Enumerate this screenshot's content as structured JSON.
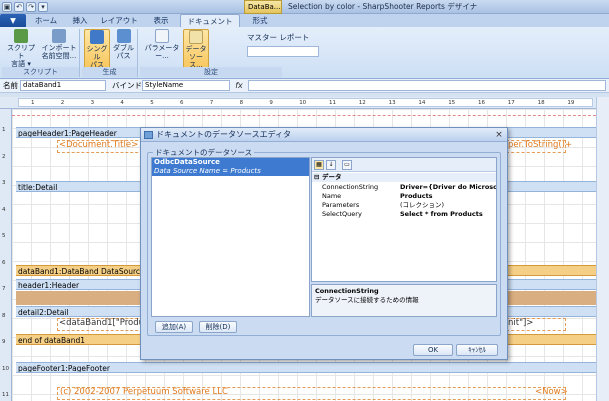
{
  "titlebar": {
    "context_tab": "DataBa...",
    "title": "Selection by color - SharpShooter Reports デザイナ",
    "qat": [
      "undo",
      "redo",
      "dropdown"
    ]
  },
  "tabs": [
    {
      "label": "ホーム"
    },
    {
      "label": "挿入"
    },
    {
      "label": "レイアウト"
    },
    {
      "label": "表示"
    },
    {
      "label": "ドキュメント"
    },
    {
      "label": "形式"
    }
  ],
  "ribbon": {
    "groups": [
      {
        "label": "スクリプト",
        "buttons": [
          {
            "label": "スクリプト",
            "label2": "言語 ▾"
          },
          {
            "label": "インポート",
            "label2": "名前空間..."
          }
        ]
      },
      {
        "label": "生成",
        "buttons": [
          {
            "label": "シングル",
            "label2": "パス"
          },
          {
            "label": "ダブル",
            "label2": "パス"
          }
        ]
      },
      {
        "label": "設定",
        "buttons": [
          {
            "label": "パラメーター..."
          },
          {
            "label": "データ",
            "label2": "ソース..."
          }
        ]
      }
    ],
    "master_label": "マスター  レポート"
  },
  "namebar": {
    "name_label": "名前",
    "name_value": "dataBand1",
    "bind_label": "バインド",
    "bind_value": "StyleName",
    "fx": "fx"
  },
  "ruler": {
    "ticks": [
      "1",
      "2",
      "3",
      "4",
      "5",
      "6",
      "7",
      "8",
      "9",
      "10",
      "11",
      "12",
      "13",
      "14",
      "15",
      "16",
      "17",
      "18",
      "19"
    ]
  },
  "left_ruler": [
    "1",
    "2",
    "3",
    "4",
    "5",
    "6",
    "7",
    "8",
    "9",
    "10",
    "11"
  ],
  "canvas": {
    "bands": [
      {
        "label": "pageHeader1:PageHeader",
        "kind": "blue"
      },
      {
        "label": "title:Detail",
        "kind": "blue"
      },
      {
        "label": "dataBand1:DataBand  DataSource",
        "kind": "orange"
      },
      {
        "label": "header1:Header",
        "kind": "blue"
      },
      {
        "label": "detail2:Detail",
        "kind": "blue"
      },
      {
        "label": "end of dataBand1",
        "kind": "orange"
      },
      {
        "label": "pageFooter1:PageFooter",
        "kind": "blue"
      }
    ],
    "fields": {
      "doc_title": "<Document.Title>",
      "page_tostring": "per.ToString()+",
      "detail_left": "<dataBand1[\"Produ",
      "detail_right": "nit\"]>",
      "copyright": "(c) 2002-2007 Perpetuum Software LLC",
      "now": "<Now>"
    }
  },
  "dialog": {
    "title": "ドキュメントのデータソースエディタ",
    "close": "×",
    "group_label": "ドキュメントのデータソース",
    "datasources": [
      {
        "name": "OdbcDataSource",
        "detail": "Data Source Name = Products"
      }
    ],
    "add_button": "追加(A)",
    "delete_button": "削除(D)",
    "propgrid": {
      "category": "データ",
      "rows": [
        {
          "name": "ConnectionString",
          "value": "Driver={Driver do Microsoft"
        },
        {
          "name": "Name",
          "value": "Products"
        },
        {
          "name": "Parameters",
          "value": "(コレクション)"
        },
        {
          "name": "SelectQuery",
          "value": "Select * from Products"
        }
      ],
      "desc_title": "ConnectionString",
      "desc_text": "データソースに接続するための情報"
    },
    "ok_button": "OK",
    "cancel_button": "ｷｬﾝｾﾙ"
  },
  "colors": {
    "accent": "#3d7ad0",
    "band_blue": "#cfe0f5",
    "band_orange": "#f6cf86",
    "field_text": "#e07a1c"
  }
}
